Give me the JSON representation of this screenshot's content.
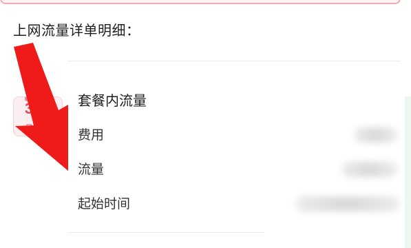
{
  "section": {
    "title": "上网流量详单明细："
  },
  "package": {
    "calendar_icon": {
      "name": "calendar-icon",
      "day_text": "3",
      "unit_text": "月",
      "color": "#e04a60"
    },
    "title": "套餐内流量",
    "fields": [
      {
        "label": "费用"
      },
      {
        "label": "流量"
      },
      {
        "label": "起始时间"
      }
    ]
  },
  "annotation": {
    "arrow_icon": "down-right-arrow-icon",
    "color": "#ef1b1b"
  }
}
